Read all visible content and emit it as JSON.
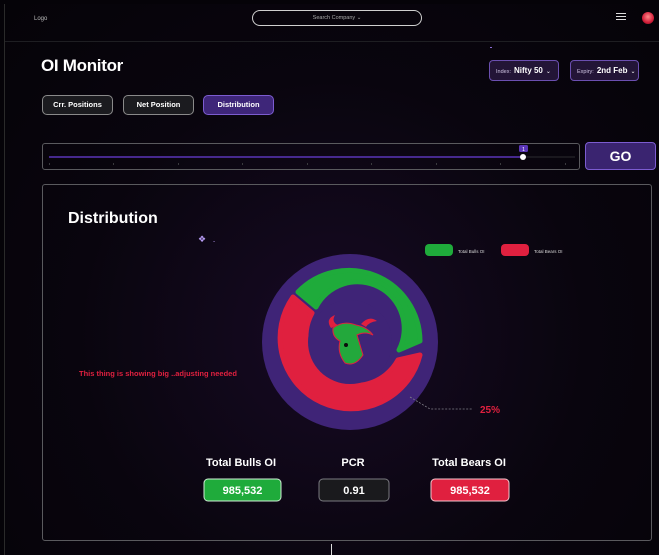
{
  "header": {
    "logo": "Logo",
    "search_placeholder": "Search Company ⌄"
  },
  "page_title": "OI Monitor",
  "filters": {
    "index_label": "Index:",
    "index_value": "Nifty 50",
    "expiry_label": "Expiry:",
    "expiry_value": "2nd Feb"
  },
  "tabs": [
    "Crr. Positions",
    "Net Position",
    "Distribution"
  ],
  "active_tab": "Distribution",
  "slider": {
    "value_label": "1",
    "position": 0.9
  },
  "go_label": "GO",
  "distribution": {
    "title": "Distribution",
    "legend": {
      "bulls": "Total Bulls OI",
      "bears": "Total Bears OI"
    },
    "annotation": "This thing is showing big ..adjusting needed",
    "percent_label": "25%",
    "stats": {
      "bulls_label": "Total Bulls OI",
      "bulls_value": "985,532",
      "pcr_label": "PCR",
      "pcr_value": "0.91",
      "bears_label": "Total Bears OI",
      "bears_value": "985,532"
    }
  },
  "colors": {
    "accent": "#3e2679",
    "bulls": "#1fab3b",
    "bears": "#e0203f",
    "ring": "#3f2477"
  }
}
